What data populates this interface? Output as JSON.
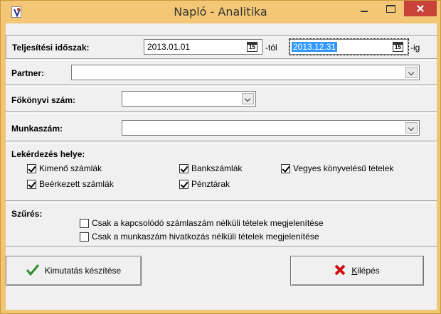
{
  "window": {
    "title": "Napló - Analitika"
  },
  "period": {
    "label": "Teljesítési időszak:",
    "from_value": "2013.01.01",
    "from_suffix": "-tól",
    "to_value": "2013.12.31",
    "to_suffix": "-ig",
    "calendar_glyph": "15"
  },
  "partner": {
    "label": "Partner:",
    "value": ""
  },
  "ledger": {
    "label": "Főkönyvi szám:",
    "value": ""
  },
  "job": {
    "label": "Munkaszám:",
    "value": ""
  },
  "query_location": {
    "label": "Lekérdezés helye:",
    "options": [
      {
        "label": "Kimenő számlák",
        "checked": true
      },
      {
        "label": "Bankszámlák",
        "checked": true
      },
      {
        "label": "Vegyes könyvelésű tételek",
        "checked": true
      },
      {
        "label": "Beérkezett számlák",
        "checked": true
      },
      {
        "label": "Pénztárak",
        "checked": true
      }
    ]
  },
  "filter": {
    "label": "Szűrés:",
    "options": [
      {
        "label": "Csak a kapcsolódó számlaszám nélküli tételek megjelenítése",
        "checked": false
      },
      {
        "label": "Csak a munkaszám hivatkozás nélküli tételek megjelenítése",
        "checked": false
      }
    ]
  },
  "buttons": {
    "report_label": "Kimutatás készítése",
    "exit_label": "Kilépés",
    "exit_accel": "K",
    "exit_rest": "ilépés"
  },
  "colors": {
    "titlebar": "#f3c775",
    "close": "#c9423a",
    "selection": "#3399ff",
    "check_icon": "#2e8b2e",
    "x_icon": "#cc1111"
  }
}
